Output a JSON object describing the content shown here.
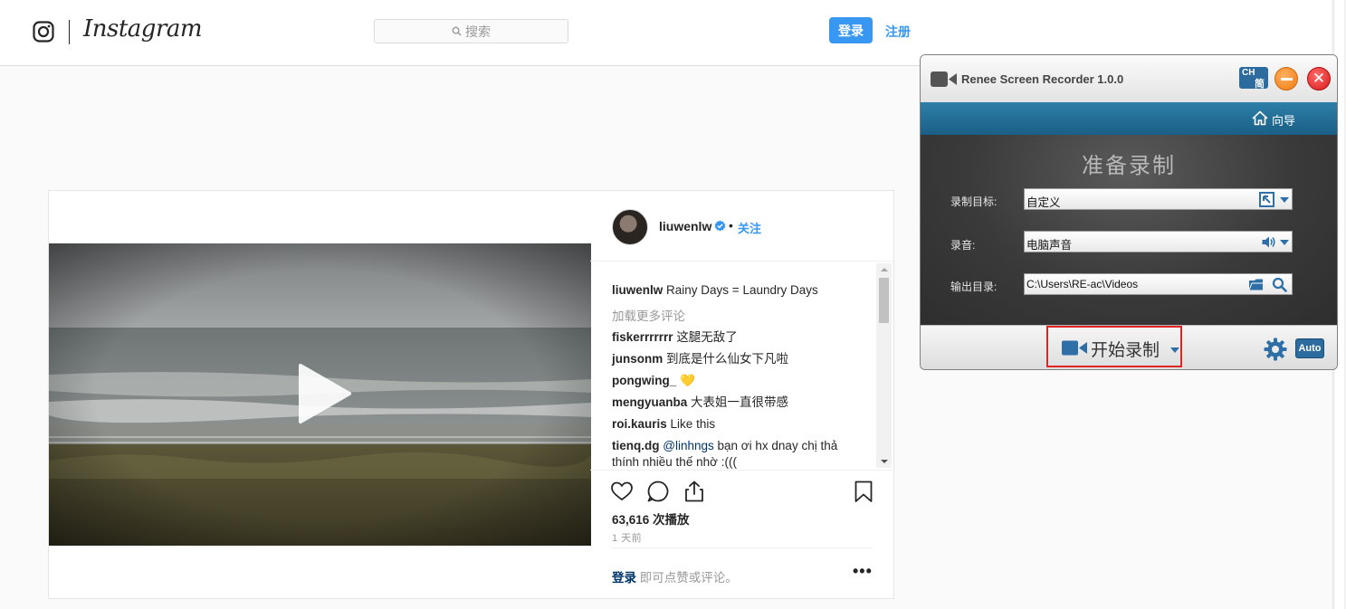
{
  "instagram": {
    "wordmark": "Instagram",
    "search_placeholder": "搜索",
    "login_button": "登录",
    "signup_link": "注册"
  },
  "post": {
    "author": "liuwenlw",
    "dot": "•",
    "follow": "关注",
    "caption": {
      "user": "liuwenlw",
      "text": "Rainy Days = Laundry Days"
    },
    "load_more": "加载更多评论",
    "comments": [
      {
        "user": "fiskerrrrrrr",
        "text": "这腿无敌了"
      },
      {
        "user": "junsonm",
        "text": "到底是什么仙女下凡啦"
      },
      {
        "user": "pongwing_",
        "text": "💛"
      },
      {
        "user": "mengyuanba",
        "text": "大表姐一直很带感"
      },
      {
        "user": "roi.kauris",
        "text": "Like this"
      },
      {
        "user": "tienq.dg",
        "mention": "@linhngs",
        "text": "bạn ơi hx dnay chị thả thính nhiều thế nhờ :((("
      }
    ],
    "views": "63,616 次播放",
    "time_ago": "1 天前",
    "login_prompt_link": "登录",
    "login_prompt_text": "即可点赞或评论。",
    "more": "•••"
  },
  "recorder": {
    "title": "Renee Screen Recorder 1.0.0",
    "lang_top": "CH",
    "lang_bottom": "简",
    "close_glyph": "✕",
    "nav_guide": "向导",
    "status": "准备录制",
    "fields": [
      {
        "label": "录制目标:",
        "value": "自定义"
      },
      {
        "label": "录音:",
        "value": "电脑声音"
      },
      {
        "label": "输出目录:",
        "value": "C:\\Users\\RE-ac\\Videos"
      }
    ],
    "start_label": "开始录制",
    "auto_label": "Auto",
    "colors": {
      "accent_blue": "#2b6b9e",
      "highlight_red": "#e02424",
      "ig_blue": "#3897f0"
    }
  }
}
